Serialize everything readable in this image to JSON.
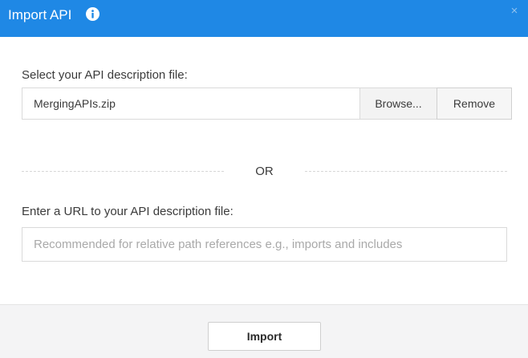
{
  "dialog": {
    "title": "Import API",
    "close_glyph": "×",
    "header_color": "#1f88e5",
    "icons": {
      "info": "info-icon",
      "close": "close-icon"
    }
  },
  "file_section": {
    "label": "Select your API description file:",
    "file_value": "MergingAPIs.zip",
    "browse_label": "Browse...",
    "remove_label": "Remove"
  },
  "separator": {
    "text": "OR"
  },
  "url_section": {
    "label": "Enter a URL to your API description file:",
    "placeholder": "Recommended for relative path references e.g., imports and includes",
    "value": ""
  },
  "footer": {
    "import_label": "Import"
  }
}
